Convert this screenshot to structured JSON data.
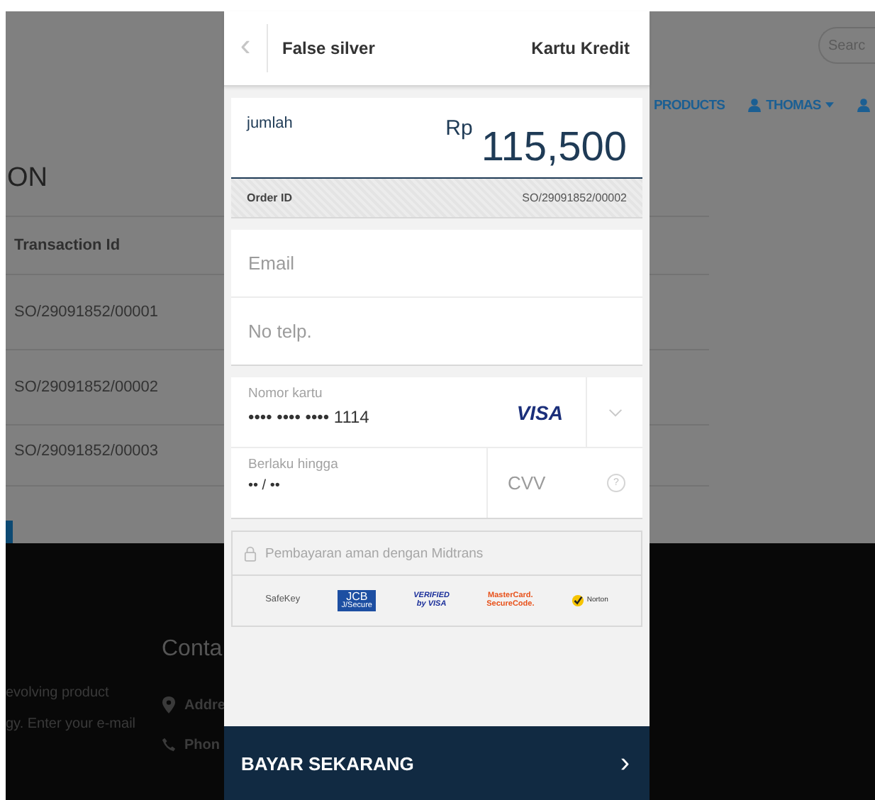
{
  "background_page": {
    "search": {
      "placeholder": "Searc"
    },
    "nav": [
      {
        "kind": "link",
        "label": "PRODUCTS"
      },
      {
        "kind": "user_menu",
        "label": "THOMAS"
      },
      {
        "kind": "user_icon"
      }
    ],
    "heading": "ON",
    "table": {
      "columns": [
        "Transaction Id"
      ],
      "rows": [
        [
          "SO/29091852/00001"
        ],
        [
          "SO/29091852/00002"
        ],
        [
          "SO/29091852/00003"
        ]
      ]
    },
    "footer": {
      "text_lines": [
        "evolving product",
        "gy. Enter your e-mail"
      ],
      "contact_title": "Conta",
      "contact_items": [
        {
          "kind": "address",
          "label": "Addre"
        },
        {
          "kind": "phone",
          "label": "Phon"
        }
      ]
    }
  },
  "modal": {
    "header": {
      "back": "‹",
      "merchant": "False silver",
      "method": "Kartu Kredit"
    },
    "amount": {
      "label": "jumlah",
      "currency": "Rp",
      "value": "115,500"
    },
    "order": {
      "label": "Order ID",
      "value": "SO/29091852/00002"
    },
    "contact_fields": [
      {
        "placeholder": "Email"
      },
      {
        "placeholder": "No telp."
      }
    ],
    "card": {
      "number_label": "Nomor kartu",
      "number_value": "•••• •••• •••• 1114",
      "brand": "VISA",
      "expiry_label": "Berlaku hingga",
      "expiry_value": "•• / ••",
      "cvv_placeholder": "CVV",
      "help": "?"
    },
    "secure": {
      "text": "Pembayaran aman dengan Midtrans",
      "logos": [
        {
          "kind": "safekey",
          "lines": [
            "SafeKey"
          ]
        },
        {
          "kind": "jcb",
          "lines": [
            "JCB",
            "J/Secure"
          ]
        },
        {
          "kind": "verified",
          "lines": [
            "VERIFIED",
            "by VISA"
          ]
        },
        {
          "kind": "mastercard",
          "lines": [
            "MasterCard.",
            "SecureCode."
          ]
        },
        {
          "kind": "norton",
          "lines": [
            "Norton"
          ]
        }
      ]
    },
    "pay_button": {
      "label": "BAYAR SEKARANG",
      "arrow": "›"
    }
  }
}
